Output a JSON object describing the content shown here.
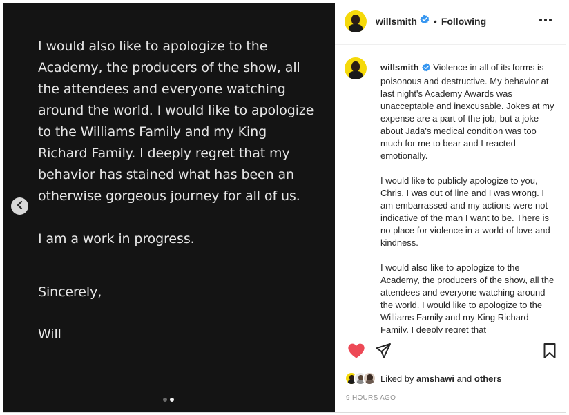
{
  "post": {
    "slide_paragraphs": [
      "I would also like to apologize to the Academy, the producers of the show, all the attendees and everyone watching around the world. I would like to apologize to the Williams Family and my King Richard Family. I deeply regret that my behavior has stained what has been an otherwise gorgeous journey for all of us.",
      "I am a work in progress.",
      "Sincerely,",
      "Will"
    ],
    "slide_count": 2,
    "active_slide": 2
  },
  "header": {
    "username": "willsmith",
    "separator": "•",
    "follow_state": "Following"
  },
  "caption": {
    "username": "willsmith",
    "paragraphs": [
      "Violence in all of its forms is poisonous and destructive. My behavior at last night's Academy Awards was unacceptable and inexcusable. Jokes at my expense are a part of the job, but a joke about Jada's medical condition was too much for me to bear and I reacted emotionally.",
      "I would like to publicly apologize to you, Chris. I was out of line and I was wrong. I am embarrassed and my actions were not indicative of the man I want to be. There is no place for violence in a world of love and kindness.",
      "I would also like to apologize to the Academy, the producers of the show, all the attendees and everyone watching around the world. I would like to apologize to the Williams Family and my King Richard Family. I deeply regret that"
    ]
  },
  "likes": {
    "prefix": "Liked by",
    "user": "amshawi",
    "connector": "and",
    "others": "others"
  },
  "timestamp": "9 HOURS AGO",
  "icons": {
    "prev": "chevron-left-icon",
    "like": "heart-filled-icon",
    "share": "paper-plane-icon",
    "save": "bookmark-icon",
    "verified": "verified-badge-icon",
    "more": "more-horizontal-icon"
  },
  "colors": {
    "like_red": "#ed4956",
    "verified_blue": "#3897f0",
    "media_bg": "#141414",
    "avatar_yellow": "#f5d90a"
  }
}
